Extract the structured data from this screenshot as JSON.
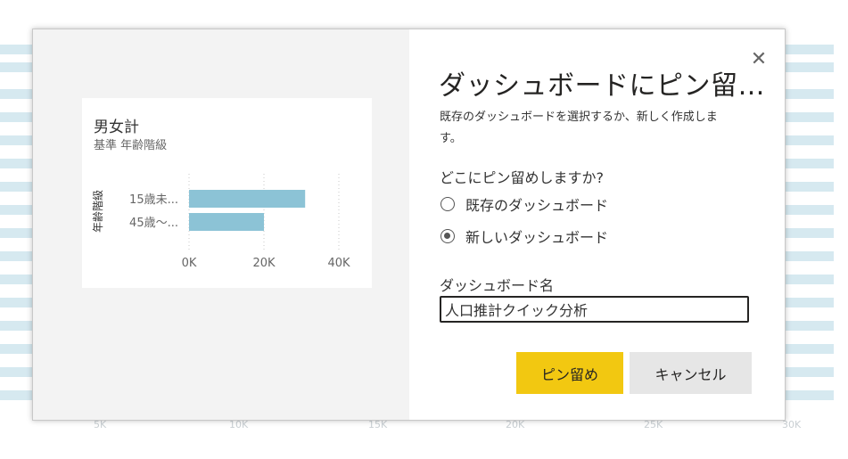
{
  "background": {
    "axis_ticks": [
      "5K",
      "10K",
      "15K",
      "20K",
      "25K",
      "30K"
    ]
  },
  "dialog": {
    "title": "ダッシュボードにピン留…",
    "description": "既存のダッシュボードを選択するか、新しく作成します。",
    "question": "どこにピン留めしますか?",
    "options": [
      {
        "label": "既存のダッシュボード",
        "selected": false
      },
      {
        "label": "新しいダッシュボード",
        "selected": true
      }
    ],
    "name_label": "ダッシュボード名",
    "name_value": "人口推計クイック分析",
    "pin_button": "ピン留め",
    "cancel_button": "キャンセル",
    "close_icon": "close-icon",
    "accent_color": "#f2c811"
  },
  "preview": {
    "title": "男女計",
    "subtitle": "基準 年齢階級"
  },
  "chart_data": {
    "type": "bar",
    "orientation": "horizontal",
    "title": "男女計",
    "subtitle": "基準 年齢階級",
    "ylabel": "年齢階級",
    "xlabel": "",
    "categories": [
      "15歳未...",
      "45歳～..."
    ],
    "values": [
      31000,
      20000
    ],
    "xlim": [
      0,
      40000
    ],
    "x_ticks": [
      "0K",
      "20K",
      "40K"
    ],
    "x_tick_values": [
      0,
      20000,
      40000
    ],
    "bar_color": "#8cc3d6",
    "grid": true
  }
}
